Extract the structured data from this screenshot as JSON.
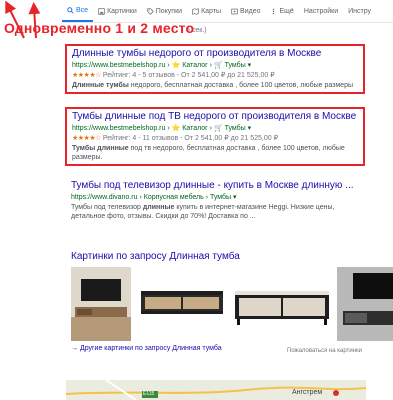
{
  "tabs": [
    {
      "label": "Все",
      "icon": "search-icon",
      "active": true
    },
    {
      "label": "Картинки",
      "icon": "image-icon"
    },
    {
      "label": "Покупки",
      "icon": "tag-icon"
    },
    {
      "label": "Карты",
      "icon": "map-icon"
    },
    {
      "label": "Видео",
      "icon": "video-icon"
    },
    {
      "label": "Ещё",
      "icon": "more-icon"
    },
    {
      "label": "Настройки"
    },
    {
      "label": "Инстру"
    }
  ],
  "stats_text": "5 сек.)",
  "callout": "Одновременно 1 и 2 место",
  "results": [
    {
      "title": "Длинные тумбы недорого от производителя в Москве",
      "url": "https://www.bestmebelshop.ru",
      "crumbs": "› ⭐ Каталог › 🛒 Тумбы ▾",
      "rating": "Рейтинг: 4 - 5 отзывов - От 2 541,00 ₽ до 21 525,00 ₽",
      "stars": "★★★★☆",
      "snippet_bold": "Длинные тумбы",
      "snippet": " недорого, бесплатная доставка , более 100 цветов, любые размеры"
    },
    {
      "title": "Тумбы длинные под ТВ недорого от производителя в Москве",
      "url": "https://www.bestmebelshop.ru",
      "crumbs": "› ⭐ Каталог › 🛒 Тумбы ▾",
      "rating": "Рейтинг: 4 - 11 отзывов - От 2 541,00 ₽ до 21 525,00 ₽",
      "stars": "★★★★☆",
      "snippet_bold": "Тумбы длинные",
      "snippet": " под тв недорого, бесплатная доставка , более 100 цветов, любые размеры."
    },
    {
      "title": "Тумбы под телевизор длинные - купить в Москве длинную ...",
      "url": "https://www.divano.ru",
      "crumbs": "› Корпусная мебель › Тумбы ▾",
      "snippet_pre": "Тумбы под телевизор ",
      "snippet_bold": "длинные",
      "snippet": " купить в интернет-магазине Heggi. Низкие цены, детальное фото, отзывы. Скидки до 70%! Доставка по ..."
    }
  ],
  "images": {
    "heading": "Картинки по запросу Длинная тумба",
    "more": "Другие картинки по запросу  Длинная тумба",
    "feedback": "Пожаловаться на картинки"
  },
  "map": {
    "label": "Ангстрем",
    "road": "E115"
  }
}
